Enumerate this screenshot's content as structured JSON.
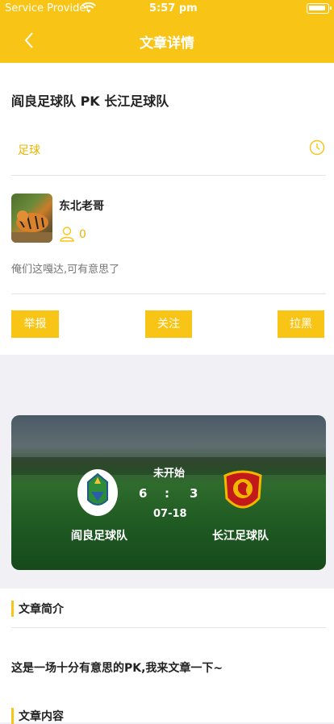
{
  "status_bar": {
    "carrier": "Service Provider",
    "time": "5:57 pm"
  },
  "nav": {
    "title": "文章详情",
    "back_icon": "chevron-left-icon"
  },
  "article": {
    "title": "阎良足球队 PK 长江足球队",
    "category": "足球",
    "author": "东北老哥",
    "follower_count": "0",
    "description": "俺们这嘎达,可有意思了"
  },
  "actions": {
    "report": "举报",
    "follow": "关注",
    "block": "拉黑"
  },
  "match": {
    "status": "未开始",
    "home_score": "6",
    "separator": ":",
    "away_score": "3",
    "date": "07-18",
    "home_team": "阎良足球队",
    "away_team": "长江足球队"
  },
  "sections": {
    "summary_title": "文章简介",
    "summary_text": "这是一场十分有意思的PK,我来文章一下~",
    "content_title": "文章内容"
  },
  "colors": {
    "accent": "#f8c416",
    "background": "#f1f1f5"
  }
}
